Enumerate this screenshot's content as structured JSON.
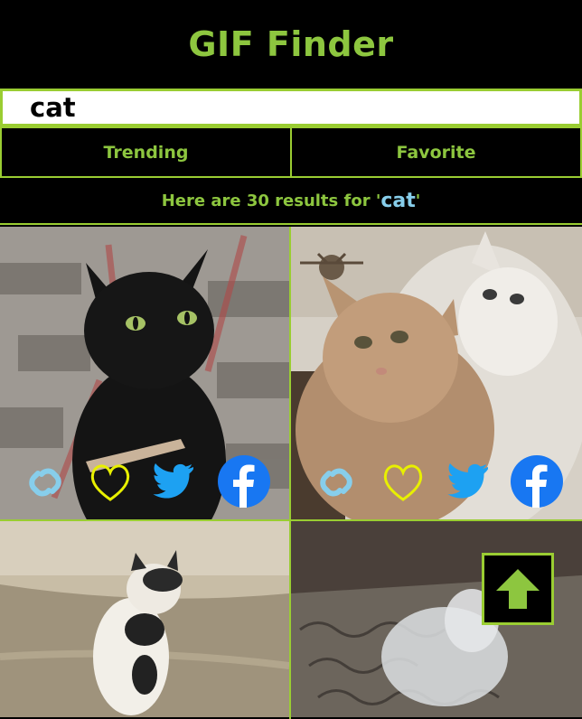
{
  "header": {
    "title": "GIF Finder"
  },
  "search": {
    "value": "cat",
    "placeholder": ""
  },
  "tabs": [
    {
      "label": "Trending"
    },
    {
      "label": "Favorite"
    }
  ],
  "results": {
    "prefix": "Here are 30 results for '",
    "term": "cat",
    "suffix": "'"
  },
  "gifs": [
    {
      "subject": "black cat with comb",
      "actions": [
        "link-icon",
        "heart-icon",
        "twitter-icon",
        "facebook-icon"
      ]
    },
    {
      "subject": "two cats nuzzling",
      "actions": [
        "link-icon",
        "heart-icon",
        "twitter-icon",
        "facebook-icon"
      ]
    },
    {
      "subject": "cat on beach",
      "actions": []
    },
    {
      "subject": "white cat on rug",
      "actions": []
    }
  ],
  "colors": {
    "accent": "#9acd32",
    "text_green": "#8dc63f",
    "link": "#87ceeb",
    "heart": "#e8f000",
    "twitter": "#1da1f2",
    "facebook": "#1877f2"
  }
}
